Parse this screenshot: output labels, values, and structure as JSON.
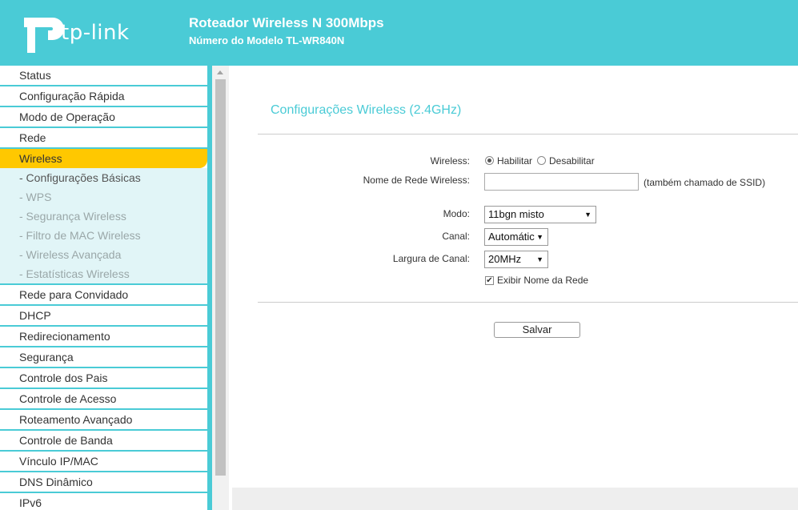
{
  "header": {
    "logo_text": "tp-link",
    "title": "Roteador Wireless N 300Mbps",
    "model": "Número do Modelo TL-WR840N"
  },
  "sidebar": {
    "items_top": [
      "Status",
      "Configuração Rápida",
      "Modo de Operação",
      "Rede"
    ],
    "active_item": "Wireless",
    "sub_items": [
      "- Configurações Básicas",
      "- WPS",
      "- Segurança Wireless",
      "- Filtro de MAC Wireless",
      "- Wireless Avançada",
      "- Estatísticas Wireless"
    ],
    "items_bottom": [
      "Rede para Convidado",
      "DHCP",
      "Redirecionamento",
      "Segurança",
      "Controle dos Pais",
      "Controle de Acesso",
      "Roteamento Avançado",
      "Controle de Banda",
      "Vínculo IP/MAC",
      "DNS Dinâmico",
      "IPv6"
    ]
  },
  "main": {
    "title": "Configurações Wireless (2.4GHz)",
    "wireless_label": "Wireless:",
    "enable_label": "Habilitar",
    "disable_label": "Desabilitar",
    "ssid_label": "Nome de Rede Wireless:",
    "ssid_value": "",
    "ssid_hint": "(também chamado de SSID)",
    "mode_label": "Modo:",
    "mode_value": "11bgn misto",
    "channel_label": "Canal:",
    "channel_value": "Automático",
    "width_label": "Largura de Canal:",
    "width_value": "20MHz",
    "broadcast_label": "Exibir Nome da Rede",
    "save_label": "Salvar"
  },
  "colors": {
    "accent": "#4acbd6",
    "active": "#ffc800"
  }
}
